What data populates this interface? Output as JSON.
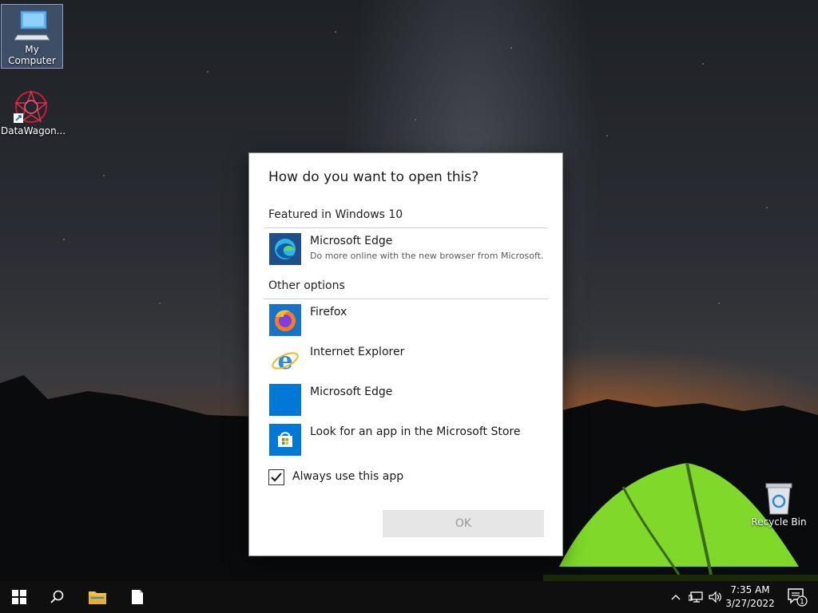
{
  "desktop": {
    "icons": [
      {
        "label": "My Computer",
        "icon": "computer-icon"
      },
      {
        "label": "DataWagon...",
        "icon": "datawagon-icon"
      },
      {
        "label": "Recycle Bin",
        "icon": "recycle-bin-icon"
      }
    ]
  },
  "dialog": {
    "title": "How do you want to open this?",
    "featured_heading": "Featured in Windows 10",
    "featured_app": {
      "name": "Microsoft Edge",
      "description": "Do more online with the new browser from Microsoft.",
      "icon": "edge-icon"
    },
    "other_heading": "Other options",
    "other_apps": [
      {
        "name": "Firefox",
        "icon": "firefox-icon"
      },
      {
        "name": "Internet Explorer",
        "icon": "internet-explorer-icon"
      },
      {
        "name": "Microsoft Edge",
        "icon": "edge-legacy-icon"
      },
      {
        "name": "Look for an app in the Microsoft Store",
        "icon": "store-icon"
      }
    ],
    "always_use_label": "Always use this app",
    "always_use_checked": true,
    "ok_label": "OK"
  },
  "taskbar": {
    "time": "7:35 AM",
    "date": "3/27/2022",
    "notification_count": "1"
  },
  "colors": {
    "accent": "#0078d7",
    "taskbar": "#0f0f10",
    "button_disabled": "#e6e6e6"
  }
}
